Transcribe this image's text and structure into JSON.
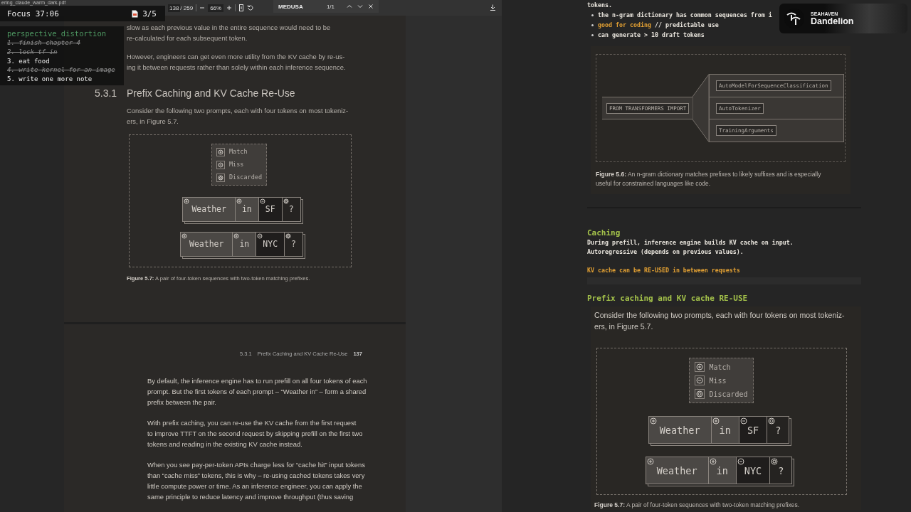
{
  "pdf_viewer": {
    "filename": "ering_claude_warm_dark.pdf",
    "page_field": "138",
    "page_total": "/ 259",
    "zoom": "66%",
    "search": {
      "value": "MEDUSA",
      "count": "1/1"
    }
  },
  "pdf_pages": [
    {
      "blocks": [
        {
          "kind": "paragraph",
          "lines": [
            "slow as each previous value in the entire sequence would need to be",
            "re-calculated for each subsequent token."
          ]
        },
        {
          "kind": "paragraph",
          "lines": [
            "However, engineers can get even more utility from the KV cache by re-us-",
            "ing it between requests rather than solely within each inference sequence."
          ]
        },
        {
          "kind": "heading",
          "number": "5.3.1",
          "title": "Prefix Caching and KV Cache Re-Use"
        },
        {
          "kind": "paragraph",
          "lines": [
            "Consider the following two prompts, each with four tokens on most tokeniz-",
            "ers, in Figure 5.7."
          ]
        },
        {
          "kind": "figure",
          "legend": [
            {
              "kind": "match",
              "label": "Match"
            },
            {
              "kind": "miss",
              "label": "Miss"
            },
            {
              "kind": "discarded",
              "label": "Discarded"
            }
          ],
          "rows": [
            [
              {
                "text": "Weather",
                "kind": "match"
              },
              {
                "text": "in",
                "kind": "match"
              },
              {
                "text": "SF",
                "kind": "miss"
              },
              {
                "text": "?",
                "kind": "discarded"
              }
            ],
            [
              {
                "text": "Weather",
                "kind": "match"
              },
              {
                "text": "in",
                "kind": "match"
              },
              {
                "text": "NYC",
                "kind": "miss"
              },
              {
                "text": "?",
                "kind": "discarded"
              }
            ]
          ]
        },
        {
          "kind": "caption",
          "label": "Figure 5.7:",
          "lines": [
            "A pair of four-token sequences with two-token matching prefixes."
          ]
        }
      ]
    },
    {
      "blocks": [
        {
          "kind": "running_head",
          "section": "5.3.1",
          "title": "Prefix Caching and KV Cache Re-Use",
          "page": "137"
        },
        {
          "kind": "paragraph",
          "lines": [
            "By default, the inference engine has to run prefill on all four tokens of each",
            "prompt. But the first tokens of each prompt – “Weather in” – form a shared",
            "prefix between the pair."
          ]
        },
        {
          "kind": "paragraph",
          "lines": [
            "With prefix caching, you can re-use the KV cache from the first request",
            "to improve TTFT on the second request by skipping prefill on the first two",
            "tokens and reading in the existing KV cache instead."
          ]
        },
        {
          "kind": "paragraph",
          "lines": [
            "When you see pay-per-token APIs charge less for “cache hit” input tokens",
            "than “cache miss” tokens, this is why – re-using cached tokens takes very",
            "little compute power or time. As an inference engineer, you can apply the",
            "same principle to reduce latency and improve throughput (thus saving"
          ]
        }
      ]
    }
  ],
  "focus": {
    "label": "Focus 37:06",
    "count": "3/5"
  },
  "todo": {
    "title": "perspective_distortion",
    "items": [
      {
        "text": "1. finish chapter 4",
        "done": true
      },
      {
        "text": "2. lock tf in",
        "done": true
      },
      {
        "text": "3. eat food",
        "done": false
      },
      {
        "text": "4. write kernel for an image",
        "done": true
      },
      {
        "text": "5. write one more note",
        "done": false
      }
    ]
  },
  "badge": {
    "overline": "SEAHAVEN",
    "title": "Dandelion"
  },
  "notes": {
    "blocks": [
      {
        "kind": "line",
        "text": "tokens."
      },
      {
        "kind": "bullets",
        "items": [
          [
            {
              "text": "the n-gram dictionary has common sequences from i",
              "highlight": false
            }
          ],
          [
            {
              "text": "good for coding",
              "highlight": true
            },
            {
              "text": "// predictable use",
              "highlight": false
            }
          ],
          [
            {
              "text": "can generate > 10 draft tokens",
              "highlight": false
            }
          ]
        ]
      },
      {
        "kind": "funnel",
        "source": "FROM TRANSFORMERS IMPORT",
        "targets": [
          "AutoModelForSequenceClassification",
          "AutoTokenizer",
          "TrainingArguments"
        ],
        "caption": {
          "label": "Figure 5.6:",
          "lines": [
            "An n-gram dictionary matches prefixes to likely suffixes and is especially",
            "useful for constrained languages like code."
          ]
        }
      },
      {
        "kind": "divider"
      },
      {
        "kind": "heading",
        "text": "Caching"
      },
      {
        "kind": "line",
        "text": "During prefill, inference engine builds KV cache on input."
      },
      {
        "kind": "line",
        "text": "Autoregressive (depends on previous values)."
      },
      {
        "kind": "highlight",
        "text": "KV cache can be RE-USED in between requests"
      },
      {
        "kind": "blank"
      },
      {
        "kind": "heading",
        "text": "Prefix caching and KV cache RE-USE"
      },
      {
        "kind": "excerpt",
        "paragraph": [
          "Consider the following two prompts, each with four tokens on most tokeniz-",
          "ers, in Figure 5.7."
        ],
        "figure": {
          "legend": [
            {
              "kind": "match",
              "label": "Match"
            },
            {
              "kind": "miss",
              "label": "Miss"
            },
            {
              "kind": "discarded",
              "label": "Discarded"
            }
          ],
          "rows": [
            [
              {
                "text": "Weather",
                "kind": "match"
              },
              {
                "text": "in",
                "kind": "match"
              },
              {
                "text": "SF",
                "kind": "miss"
              },
              {
                "text": "?",
                "kind": "discarded"
              }
            ],
            [
              {
                "text": "Weather",
                "kind": "match"
              },
              {
                "text": "in",
                "kind": "match"
              },
              {
                "text": "NYC",
                "kind": "miss"
              },
              {
                "text": "?",
                "kind": "discarded"
              }
            ]
          ]
        },
        "caption": {
          "label": "Figure 5.7:",
          "lines": [
            "A pair of four-token sequences with two-token matching prefixes."
          ]
        }
      }
    ]
  }
}
